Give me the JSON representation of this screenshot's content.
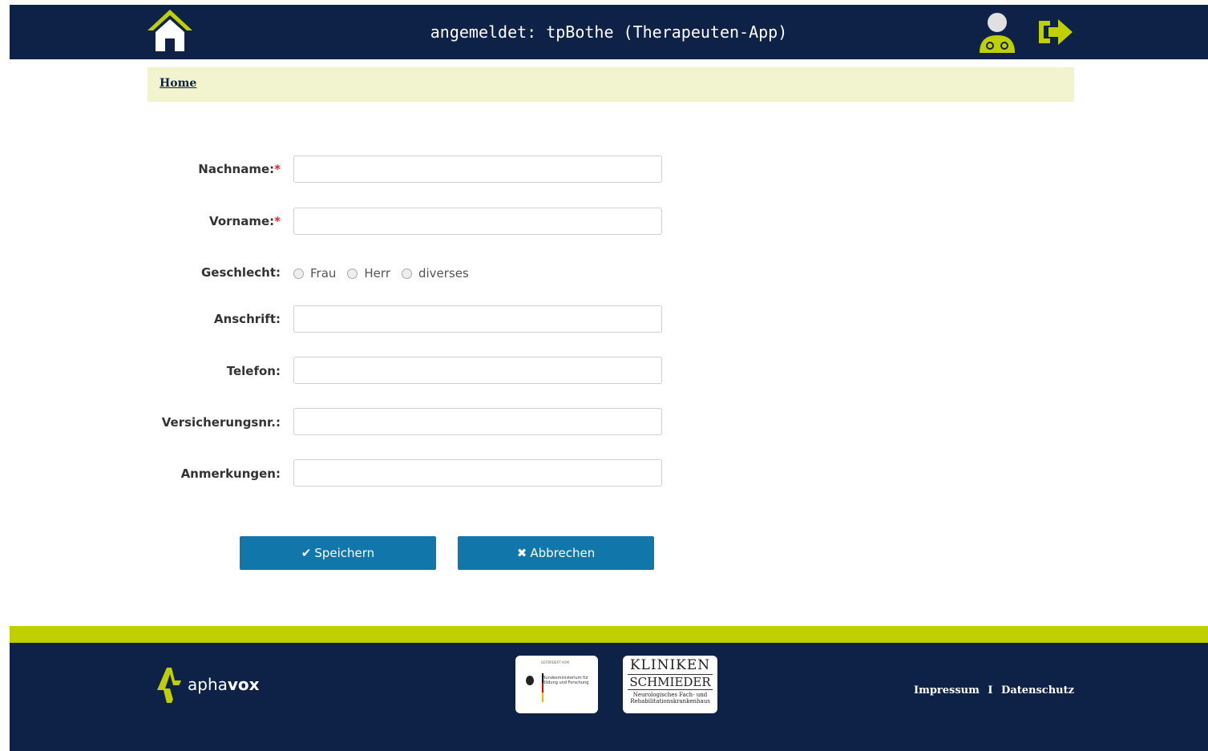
{
  "header": {
    "title": "angemeldet: tpBothe (Therapeuten-App)"
  },
  "breadcrumb": {
    "home": "Home"
  },
  "form": {
    "nachname_label": "Nachname:",
    "vorname_label": "Vorname:",
    "required_mark": "*",
    "geschlecht_label": "Geschlecht:",
    "geschlecht_options": [
      "Frau",
      "Herr",
      "diverses"
    ],
    "anschrift_label": "Anschrift:",
    "telefon_label": "Telefon:",
    "versicherungsnr_label": "Versicherungsnr.:",
    "anmerkungen_label": "Anmerkungen:"
  },
  "buttons": {
    "save": "Speichern",
    "cancel": "Abbrechen"
  },
  "footer": {
    "brand_light": "apha",
    "brand_bold": "vox",
    "bmbf_title": "GEFÖRDERT VOM",
    "bmbf_text": "Bundesministerium für Bildung und Forschung",
    "kliniken_line1": "KLINIKEN",
    "kliniken_line2": "SCHMIEDER",
    "kliniken_line3": "Neurologisches Fach- und Rehabilitationskrankenhaus",
    "impressum": "Impressum",
    "separator": "I",
    "datenschutz": "Datenschutz"
  },
  "colors": {
    "navy": "#0e2248",
    "lime": "#bfcf00",
    "button_blue": "#1177aa",
    "breadcrumb_bg": "#f1f4cf"
  }
}
